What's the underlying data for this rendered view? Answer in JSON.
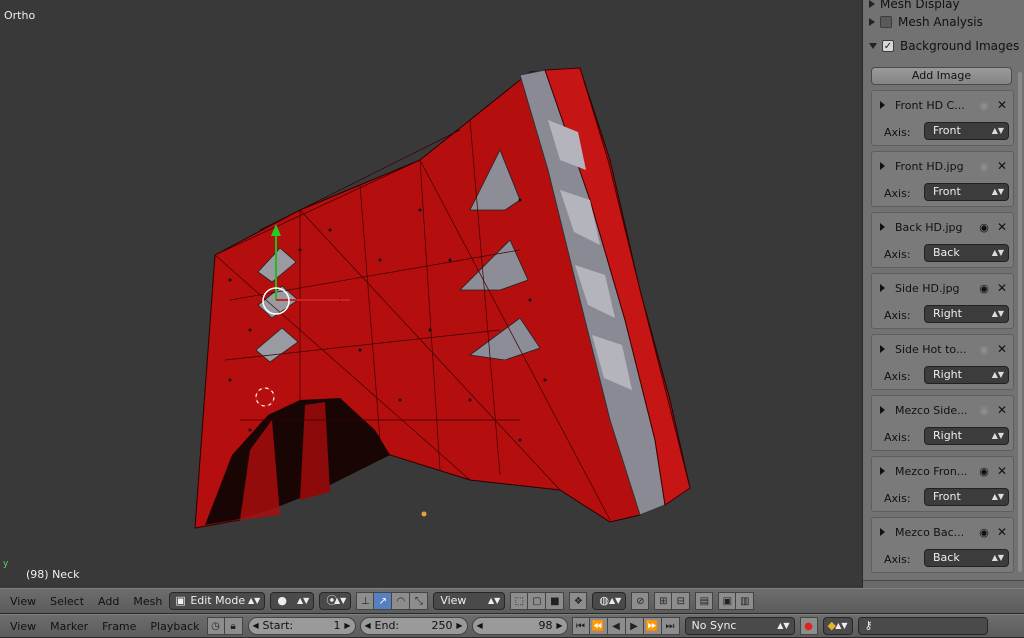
{
  "viewport": {
    "view_mode": "Ortho",
    "object_label": "(98) Neck"
  },
  "panel": {
    "sections": [
      {
        "label": "Mesh Display",
        "checked": false
      },
      {
        "label": "Mesh Analysis",
        "checked": false
      },
      {
        "label": "Background Images",
        "checked": true
      }
    ],
    "add_image_label": "Add Image",
    "axis_label": "Axis:",
    "images": [
      {
        "name": "Front HD C...",
        "axis": "Front",
        "visible": false
      },
      {
        "name": "Front HD.jpg",
        "axis": "Front",
        "visible": false
      },
      {
        "name": "Back HD.jpg",
        "axis": "Back",
        "visible": true
      },
      {
        "name": "Side HD.jpg",
        "axis": "Right",
        "visible": true
      },
      {
        "name": "Side Hot to...",
        "axis": "Right",
        "visible": false
      },
      {
        "name": "Mezco Side...",
        "axis": "Right",
        "visible": false
      },
      {
        "name": "Mezco Fron...",
        "axis": "Front",
        "visible": true
      },
      {
        "name": "Mezco Bac...",
        "axis": "Back",
        "visible": true
      }
    ]
  },
  "header3d": {
    "menus": [
      "View",
      "Select",
      "Add",
      "Mesh"
    ],
    "mode": "Edit Mode",
    "orientation": "View"
  },
  "timeline": {
    "menus": [
      "View",
      "Marker",
      "Frame",
      "Playback"
    ],
    "start_label": "Start:",
    "start_value": "1",
    "end_label": "End:",
    "end_value": "250",
    "current_frame": "98",
    "sync": "No Sync"
  }
}
